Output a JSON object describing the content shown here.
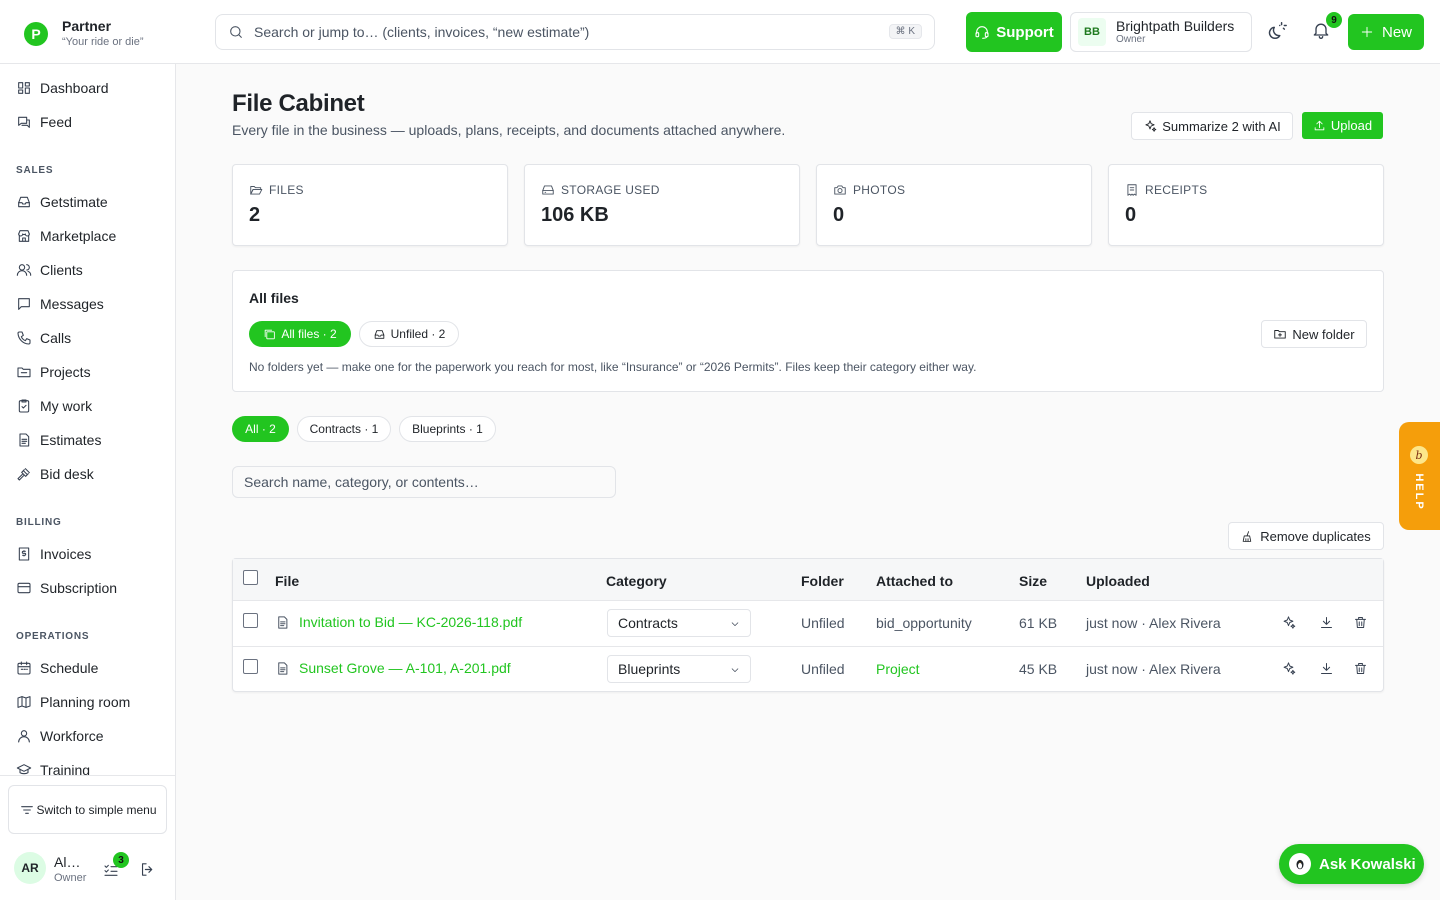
{
  "brand": {
    "logo_letter": "P",
    "name": "Partner",
    "tagline": "“Your ride or die”"
  },
  "search": {
    "placeholder": "Search or jump to… (clients, invoices, “new estimate”)",
    "shortcut": "⌘ K"
  },
  "header": {
    "support_label": "Support",
    "workspace": {
      "initials": "BB",
      "name": "Brightpath Builders",
      "role": "Owner"
    },
    "notification_count": "9",
    "new_label": "New"
  },
  "sidebar": {
    "top_items": [
      {
        "label": "Dashboard",
        "icon": "dashboard-icon"
      },
      {
        "label": "Feed",
        "icon": "feed-icon"
      }
    ],
    "sections": [
      {
        "title": "SALES",
        "items": [
          {
            "label": "Getstimate",
            "icon": "inbox-icon"
          },
          {
            "label": "Marketplace",
            "icon": "store-icon"
          },
          {
            "label": "Clients",
            "icon": "users-icon"
          },
          {
            "label": "Messages",
            "icon": "message-icon"
          },
          {
            "label": "Calls",
            "icon": "phone-icon"
          },
          {
            "label": "Projects",
            "icon": "folder-icon"
          },
          {
            "label": "My work",
            "icon": "clipboard-icon"
          },
          {
            "label": "Estimates",
            "icon": "document-icon"
          },
          {
            "label": "Bid desk",
            "icon": "gavel-icon"
          }
        ]
      },
      {
        "title": "BILLING",
        "items": [
          {
            "label": "Invoices",
            "icon": "invoice-icon"
          },
          {
            "label": "Subscription",
            "icon": "credit-card-icon"
          }
        ]
      },
      {
        "title": "OPERATIONS",
        "items": [
          {
            "label": "Schedule",
            "icon": "calendar-icon"
          },
          {
            "label": "Planning room",
            "icon": "map-icon"
          },
          {
            "label": "Workforce",
            "icon": "workforce-icon"
          },
          {
            "label": "Training",
            "icon": "graduation-cap-icon"
          }
        ]
      }
    ],
    "simple_menu_label": "Switch to simple menu",
    "user": {
      "initials": "AR",
      "name": "Alex Rivera",
      "role": "Owner",
      "task_count": "3"
    }
  },
  "page": {
    "title": "File Cabinet",
    "subtitle": "Every file in the business — uploads, plans, receipts, and documents attached anywhere.",
    "summarize_label": "Summarize 2 with AI",
    "upload_label": "Upload"
  },
  "stats": [
    {
      "label": "FILES",
      "value": "2",
      "icon": "folder-open-icon"
    },
    {
      "label": "STORAGE USED",
      "value": "106 KB",
      "icon": "hard-drive-icon"
    },
    {
      "label": "PHOTOS",
      "value": "0",
      "icon": "camera-icon"
    },
    {
      "label": "RECEIPTS",
      "value": "0",
      "icon": "receipt-icon"
    }
  ],
  "folders": {
    "title": "All files",
    "chips": [
      {
        "label": "All files · 2",
        "active": true
      },
      {
        "label": "Unfiled · 2",
        "active": false
      }
    ],
    "new_folder_label": "New folder",
    "hint": "No folders yet — make one for the paperwork you reach for most, like “Insurance” or “2026 Permits”. Files keep their category either way."
  },
  "filters": [
    {
      "label": "All · 2",
      "active": true
    },
    {
      "label": "Contracts · 1",
      "active": false
    },
    {
      "label": "Blueprints · 1",
      "active": false
    }
  ],
  "file_search": {
    "placeholder": "Search name, category, or contents…"
  },
  "remove_duplicates_label": "Remove duplicates",
  "table": {
    "columns": [
      "File",
      "Category",
      "Folder",
      "Attached to",
      "Size",
      "Uploaded"
    ],
    "rows": [
      {
        "name": "Invitation to Bid — KC-2026-118.pdf",
        "category": "Contracts",
        "folder": "Unfiled",
        "attached_to": "bid_opportunity",
        "attached_is_link": false,
        "size": "61 KB",
        "uploaded": "just now · Alex Rivera"
      },
      {
        "name": "Sunset Grove — A-101, A-201.pdf",
        "category": "Blueprints",
        "folder": "Unfiled",
        "attached_to": "Project",
        "attached_is_link": true,
        "size": "45 KB",
        "uploaded": "just now · Alex Rivera"
      }
    ]
  },
  "help_tab": {
    "badge": "b",
    "label": "HELP"
  },
  "ask_label": "Ask Kowalski",
  "colors": {
    "accent": "#22c520",
    "help": "#f59e0b",
    "text": "#1f2328",
    "muted": "#4b5563",
    "border": "#e2e4e8"
  }
}
